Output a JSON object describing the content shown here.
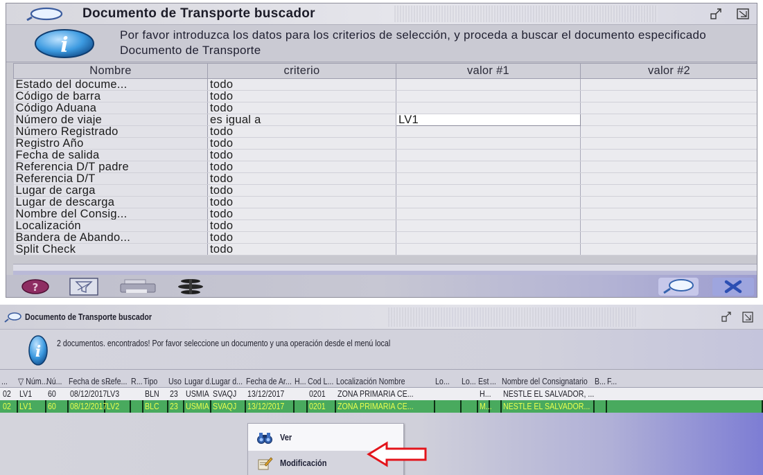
{
  "search_window": {
    "title": "Documento de Transporte buscador",
    "instruction": "Por favor introduzca los datos para los criterios de selección, y proceda a buscar el documento especificado Documento de Transporte",
    "columns": [
      "Nombre",
      "criterio",
      "valor #1",
      "valor #2"
    ],
    "rows": [
      {
        "name": "Estado del docume...",
        "criterio": "todo",
        "v1": "",
        "v2": ""
      },
      {
        "name": "Código de barra",
        "criterio": "todo",
        "v1": "",
        "v2": ""
      },
      {
        "name": "Código Aduana",
        "criterio": "todo",
        "v1": "",
        "v2": ""
      },
      {
        "name": "Número de viaje",
        "criterio": "es igual a",
        "v1": "LV1",
        "v2": ""
      },
      {
        "name": "Número Registrado",
        "criterio": "todo",
        "v1": "",
        "v2": ""
      },
      {
        "name": "Registro Año",
        "criterio": "todo",
        "v1": "",
        "v2": ""
      },
      {
        "name": "Fecha de salida",
        "criterio": "todo",
        "v1": "",
        "v2": ""
      },
      {
        "name": "Referencia D/T padre",
        "criterio": "todo",
        "v1": "",
        "v2": ""
      },
      {
        "name": "Referencia D/T",
        "criterio": "todo",
        "v1": "",
        "v2": ""
      },
      {
        "name": "Lugar de carga",
        "criterio": "todo",
        "v1": "",
        "v2": ""
      },
      {
        "name": "Lugar de descarga",
        "criterio": "todo",
        "v1": "",
        "v2": ""
      },
      {
        "name": "Nombre del Consig...",
        "criterio": "todo",
        "v1": "",
        "v2": ""
      },
      {
        "name": "Localización",
        "criterio": "todo",
        "v1": "",
        "v2": ""
      },
      {
        "name": "Bandera de Abando...",
        "criterio": "todo",
        "v1": "",
        "v2": ""
      },
      {
        "name": "Split Check",
        "criterio": "todo",
        "v1": "",
        "v2": ""
      }
    ],
    "toolbar_icons": [
      "help-icon",
      "clear-filter-icon",
      "print-icon",
      "traffic-light-icon"
    ],
    "action_icons": [
      "search-icon",
      "close-icon"
    ]
  },
  "results_window": {
    "title": "Documento de Transporte buscador",
    "message": "2 documentos. encontrados! Por favor seleccione un documento y una operación desde el menú local",
    "columns": [
      "...",
      "▽ Núm...",
      "Nú...",
      "Fecha de s...",
      "Refe...",
      "R...",
      "Tipo",
      "Uso",
      "Lugar d...",
      "Lugar d...",
      "Fecha de Ar...",
      "H...",
      "Cod L...",
      "Localización Nombre",
      "Lo...",
      "Lo...",
      "Est",
      "...",
      "Nombre del Consignatario",
      "B...",
      "F..."
    ],
    "rows": [
      [
        "02",
        "LV1",
        "60",
        "08/12/2017",
        "LV3",
        "",
        "BLN",
        "23",
        "USMIA",
        "SVAQJ",
        "13/12/2017",
        "",
        "0201",
        "ZONA PRIMARIA CE...",
        "",
        "",
        "H...",
        "",
        "NESTLE EL SALVADOR, ...",
        "",
        ""
      ],
      [
        "02",
        "LV1",
        "60",
        "08/12/2017",
        "LV2",
        "",
        "BLC",
        "23",
        "USMIA",
        "SVAQJ",
        "13/12/2017",
        "",
        "0201",
        "ZONA PRIMARIA CE...",
        "",
        "",
        "M...",
        "",
        "NESTLE EL SALVADOR...",
        "",
        ""
      ]
    ],
    "context_menu": [
      {
        "label": "Ver",
        "icon": "binoculars-icon"
      },
      {
        "label": "Modificación",
        "icon": "edit-document-icon"
      }
    ]
  }
}
